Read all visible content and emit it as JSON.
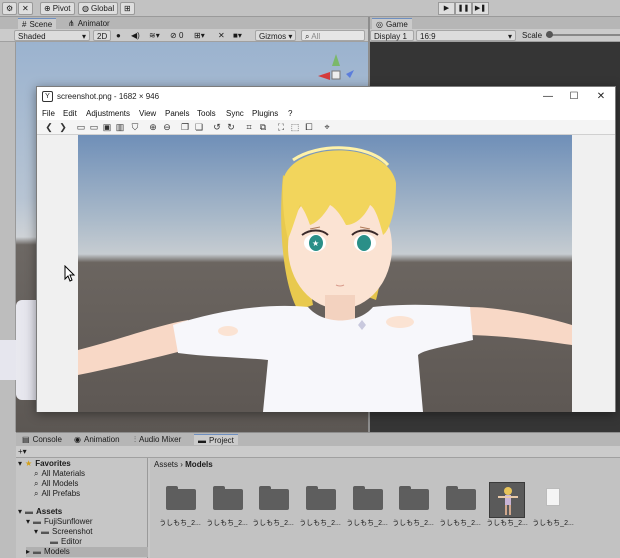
{
  "unity": {
    "toolbar": {
      "pivot_label": "Pivot",
      "global_label": "Global"
    },
    "scene_tabs": [
      "Scene",
      "Animator"
    ],
    "game_tab": "Game",
    "scene_bar": {
      "shading_mode": "Shaded",
      "mode_2d": "2D",
      "effects_count": "0",
      "gizmos_label": "Gizmos",
      "search_placeholder": "All"
    },
    "game_bar": {
      "display": "Display 1",
      "aspect": "16:9",
      "scale_label": "Scale"
    },
    "bottom_tabs": [
      "Console",
      "Animation",
      "Audio Mixer",
      "Project"
    ],
    "project": {
      "tree": [
        {
          "label": "Favorites",
          "indent": 0,
          "kind": "star"
        },
        {
          "label": "All Materials",
          "indent": 1,
          "kind": "search"
        },
        {
          "label": "All Models",
          "indent": 1,
          "kind": "search"
        },
        {
          "label": "All Prefabs",
          "indent": 1,
          "kind": "search"
        },
        {
          "label": "Assets",
          "indent": 0,
          "kind": "folder"
        },
        {
          "label": "FujiSunflower",
          "indent": 1,
          "kind": "folder"
        },
        {
          "label": "Screenshot",
          "indent": 2,
          "kind": "folder"
        },
        {
          "label": "Editor",
          "indent": 3,
          "kind": "folder"
        },
        {
          "label": "Models",
          "indent": 2,
          "kind": "folder"
        }
      ],
      "breadcrumb": [
        "Assets",
        "Models"
      ],
      "assets": [
        {
          "label": "うしもち_2...",
          "kind": "folder"
        },
        {
          "label": "うしもち_2...",
          "kind": "folder"
        },
        {
          "label": "うしもち_2...",
          "kind": "folder"
        },
        {
          "label": "うしもち_2...",
          "kind": "folder"
        },
        {
          "label": "うしもち_2...",
          "kind": "folder"
        },
        {
          "label": "うしもち_2...",
          "kind": "folder"
        },
        {
          "label": "うしもち_2...",
          "kind": "folder"
        },
        {
          "label": "うしもち_2...",
          "kind": "model"
        },
        {
          "label": "うしもち_2...",
          "kind": "file"
        }
      ]
    }
  },
  "viewer": {
    "title": "screenshot.png - 1682 × 946",
    "menu": [
      "File",
      "Edit",
      "Adjustments",
      "View",
      "Panels",
      "Tools",
      "Sync",
      "Plugins",
      "?"
    ],
    "window_controls": {
      "minimize": "—",
      "maximize": "☐",
      "close": "✕"
    }
  },
  "colors": {
    "unity_bg": "#c8c8c8",
    "viewer_bg": "#f0f0f0",
    "hair": "#f2d55c",
    "shirt": "#f7f7fb",
    "eyes": "#2a8f88"
  }
}
